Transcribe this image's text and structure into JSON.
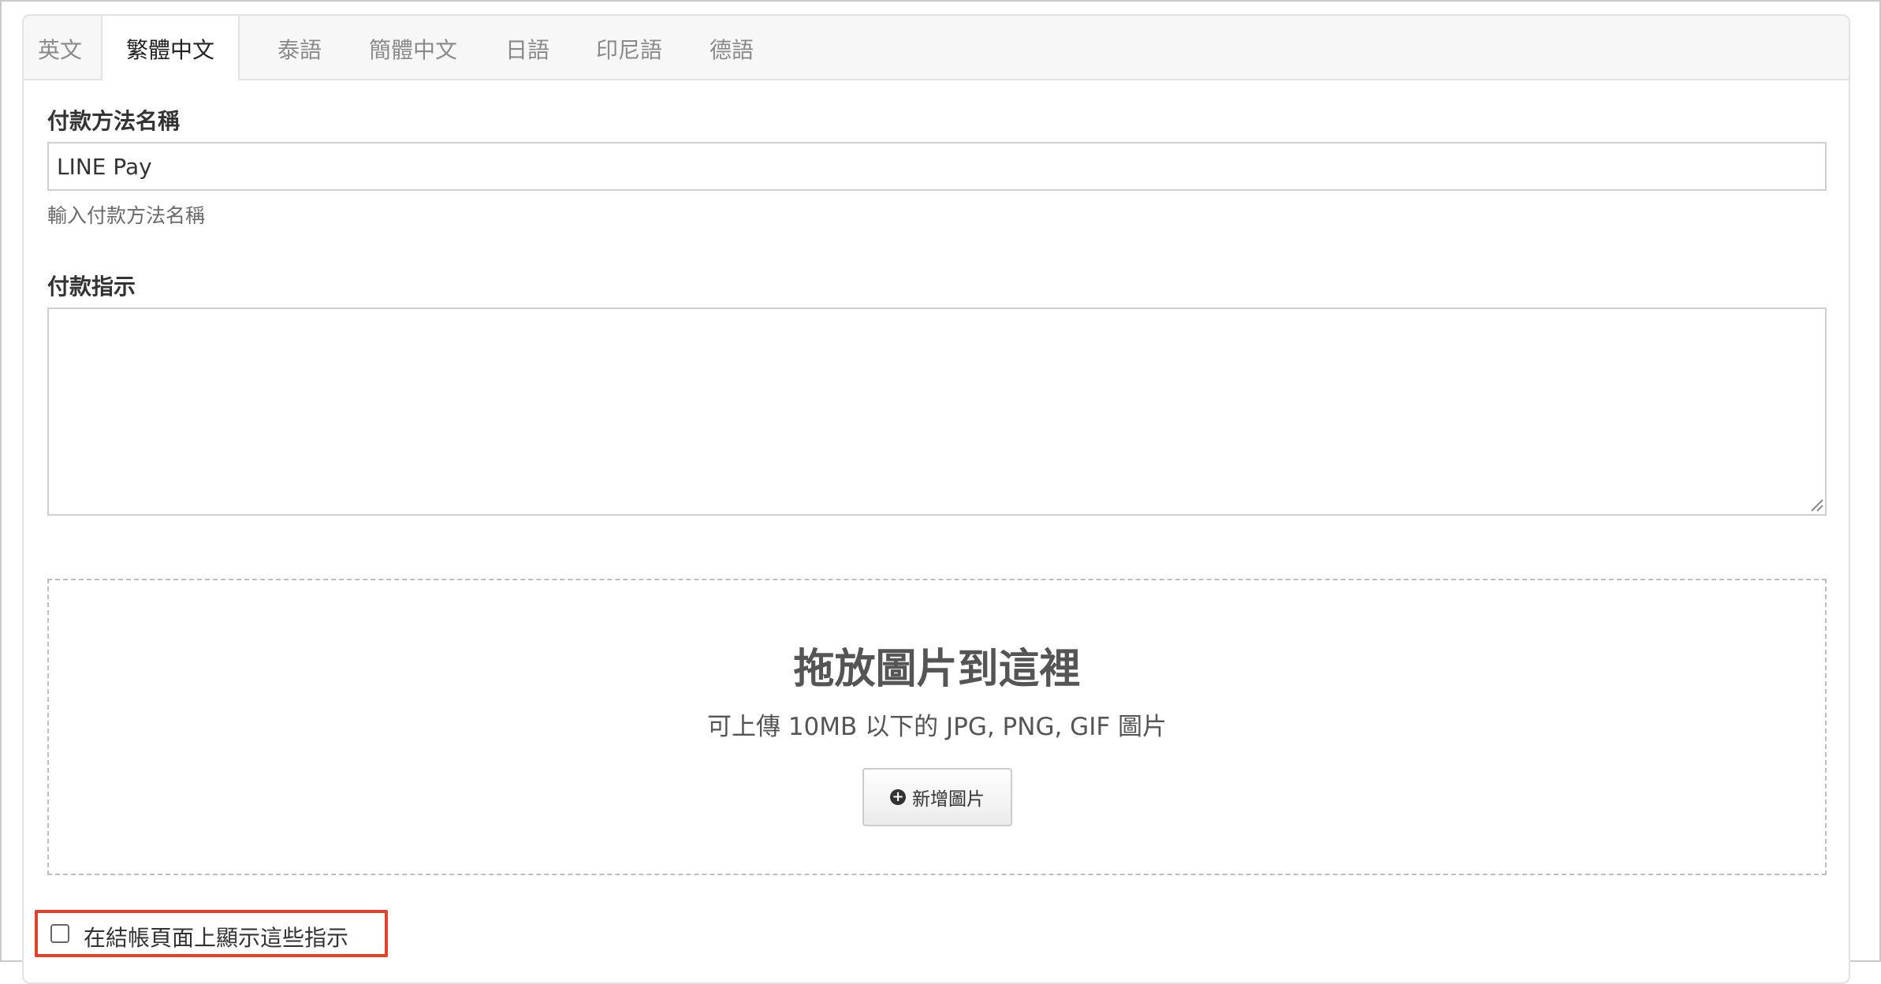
{
  "tabs": [
    {
      "label": "英文"
    },
    {
      "label": "繁體中文",
      "active": true
    },
    {
      "label": "泰語"
    },
    {
      "label": "簡體中文"
    },
    {
      "label": "日語"
    },
    {
      "label": "印尼語"
    },
    {
      "label": "德語"
    }
  ],
  "payment_name": {
    "label": "付款方法名稱",
    "value": "LINE Pay",
    "help": "輸入付款方法名稱"
  },
  "instructions": {
    "label": "付款指示",
    "value": ""
  },
  "dropzone": {
    "title": "拖放圖片到這裡",
    "subtitle": "可上傳 10MB 以下的 JPG, PNG, GIF 圖片",
    "button_label": "新增圖片",
    "button_icon": "plus-circle-icon"
  },
  "show_on_checkout": {
    "label": "在結帳頁面上顯示這些指示",
    "checked": false
  },
  "colors": {
    "highlight": "#e2412c",
    "active_tab_text": "#222222",
    "inactive_tab_text": "#8a8a8a"
  }
}
